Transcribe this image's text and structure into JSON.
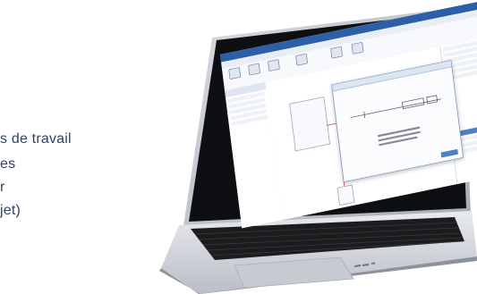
{
  "background_text": {
    "line1": "s de travail",
    "line2": "es",
    "line3": "r",
    "line4": "jet)"
  },
  "colors": {
    "text": "#2f3f6e",
    "laptop_silver": "#cfd3d9",
    "keyboard": "#1c1c1e",
    "app_accent": "#2d5fa8",
    "wire": "#d33333"
  }
}
